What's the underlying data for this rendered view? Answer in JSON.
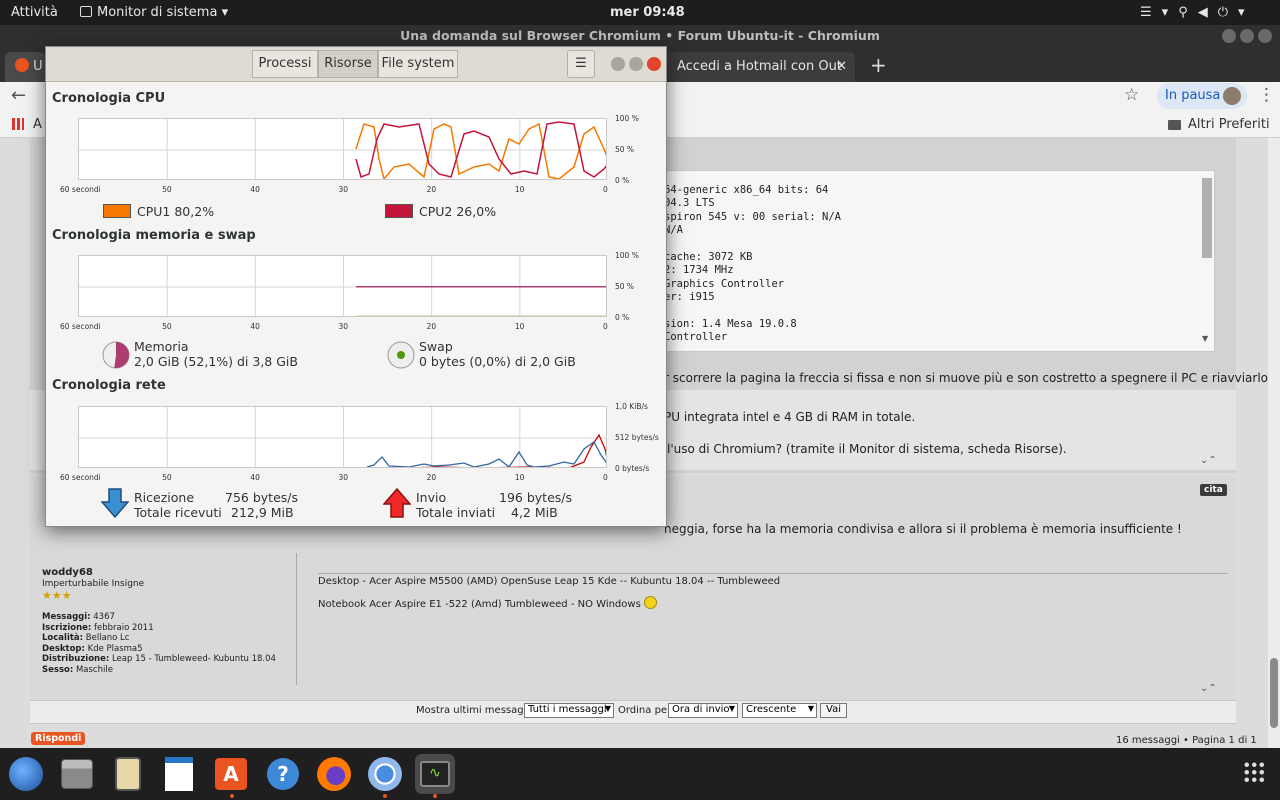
{
  "topbar": {
    "activities": "Attività",
    "app_menu": "Monitor di sistema",
    "clock": "mer 09:48"
  },
  "chrome": {
    "window_title": "Una domanda sul Browser Chromium • Forum Ubuntu-it - Chromium",
    "tab_first_partial": "U",
    "tab_hotmail": "Accedi a Hotmail con Out",
    "paused_label": "In pausa",
    "apps_partial": "A",
    "other_bookmarks": "Altri Preferiti"
  },
  "page": {
    "code_lines": [
      "64-generic x86_64 bits: 64",
      "04.3 LTS",
      "spiron 545 v: 00 serial: N/A",
      "N/A",
      "",
      "cache: 3072 KB",
      "2: 1734 MHz",
      "Graphics Controller",
      "er: i915",
      "",
      "sion: 1.4 Mesa 19.0.8",
      "Controller"
    ],
    "line_scroll": "r scorrere la pagina la freccia si fissa e non si muove più e son costretto a spegnere il PC e riavviarlo.",
    "line_gpu": "PU integrata intel e 4 GB di RAM in totale.",
    "line_chromium": "l'uso di Chromium? (tramite il Monitor di sistema, scheda Risorse).",
    "cita": "cita",
    "reply_text": "heggia, forse ha la memoria condivisa e allora si il problema è memoria insufficiente !",
    "sig1": "Desktop - Acer Aspire M5500 (AMD) OpenSuse Leap 15 Kde -- Kubuntu 18.04 -- Tumbleweed",
    "sig2": "Notebook Acer Aspire E1 -522 (Amd) Tumbleweed - NO Windows",
    "user": {
      "name": "woddy68",
      "rank": "Imperturbabile Insigne",
      "fields": [
        [
          "Messaggi:",
          "4367"
        ],
        [
          "Iscrizione:",
          "febbraio 2011"
        ],
        [
          "Località:",
          "Bellano Lc"
        ],
        [
          "Desktop:",
          "Kde Plasma5"
        ],
        [
          "Distribuzione:",
          "Leap 15 - Tumbleweed- Kubuntu 18.04"
        ],
        [
          "Sesso:",
          "Maschile"
        ]
      ]
    },
    "filter": {
      "show_label": "Mostra ultimi messaggi:",
      "show_value": "Tutti i messaggi",
      "sort_label": "Ordina per",
      "sort_value": "Ora di invio",
      "order_value": "Crescente",
      "go": "Vai"
    },
    "rispondi": "Rispondi",
    "pagination": "16 messaggi • Pagina 1 di 1"
  },
  "sysmon": {
    "tabs": [
      "Processi",
      "Risorse",
      "File system"
    ],
    "cpu_title": "Cronologia CPU",
    "mem_title": "Cronologia memoria e swap",
    "net_title": "Cronologia rete",
    "x_ticks": [
      "60 secondi",
      "50",
      "40",
      "30",
      "20",
      "10",
      "0"
    ],
    "pct_ticks": [
      "100 %",
      "50 %",
      "0 %"
    ],
    "net_ticks": [
      "1,0 KiB/s",
      "512 bytes/s",
      "0 bytes/s"
    ],
    "cpu1": {
      "label": "CPU1",
      "value": "80,2%",
      "color": "#f57900"
    },
    "cpu2": {
      "label": "CPU2",
      "value": "26,0%",
      "color": "#c4143a"
    },
    "memory": {
      "label": "Memoria",
      "value": "2,0 GiB (52,1%) di 3,8 GiB",
      "fraction": 0.521,
      "color": "#ad3d6e"
    },
    "swap": {
      "label": "Swap",
      "value": "0 bytes (0,0%) di 2,0 GiB",
      "fraction": 0.0,
      "color": "#4e9a06"
    },
    "receive": {
      "label": "Ricezione",
      "rate": "756 bytes/s",
      "total_label": "Totale ricevuti",
      "total": "212,9 MiB",
      "color": "#3465a4"
    },
    "send": {
      "label": "Invio",
      "rate": "196 bytes/s",
      "total_label": "Totale inviati",
      "total": "4,2 MiB",
      "color": "#cc0000"
    }
  },
  "dock": {
    "apps": [
      "thunderbird",
      "files",
      "rhythmbox",
      "libreoffice-writer",
      "ubuntu-software",
      "help",
      "firefox",
      "chromium",
      "system-monitor",
      "show-applications"
    ]
  }
}
